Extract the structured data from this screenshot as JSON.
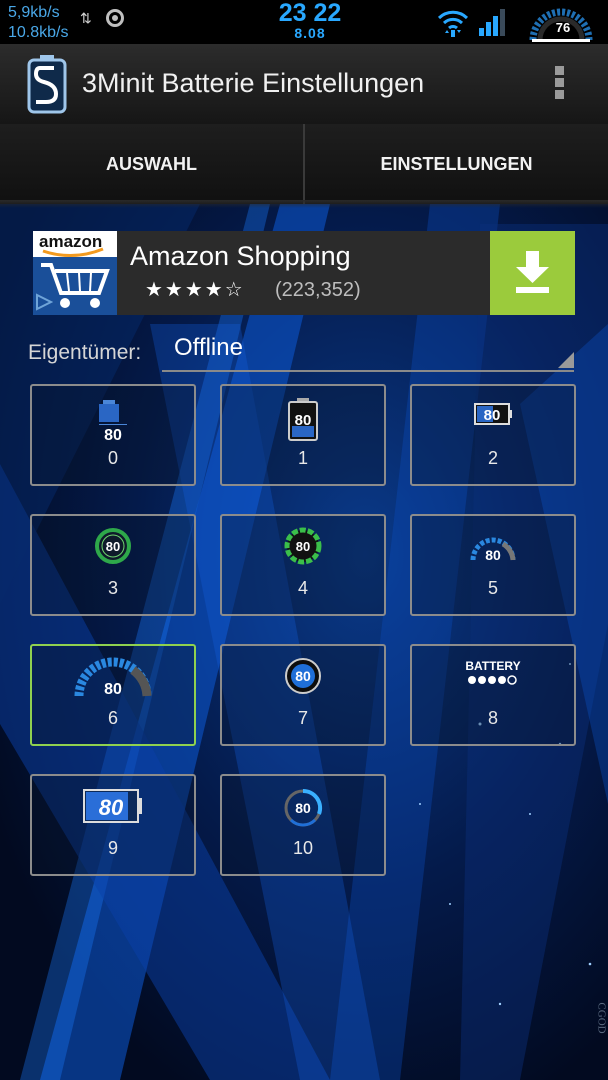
{
  "status_bar": {
    "upload_speed": "5,9kb/s",
    "download_speed": "10.8kb/s",
    "time": "23 22",
    "date": "8.08",
    "battery_level": "76"
  },
  "action_bar": {
    "title": "3Minit Batterie Einstellungen"
  },
  "tabs": [
    {
      "label": "AUSWAHL"
    },
    {
      "label": "EINSTELLUNGEN"
    }
  ],
  "ad": {
    "brand": "amazon",
    "title": "Amazon Shopping",
    "stars": "★★★★☆",
    "rating_count": "(223,352)"
  },
  "owner": {
    "label": "Eigentümer:",
    "value": "Offline"
  },
  "styles": [
    {
      "number": "0",
      "icon": "battery-vertical-icon",
      "value": "80",
      "selected": false
    },
    {
      "number": "1",
      "icon": "battery-boxed-icon",
      "value": "80",
      "selected": false
    },
    {
      "number": "2",
      "icon": "battery-horizontal-icon",
      "value": "80",
      "selected": false
    },
    {
      "number": "3",
      "icon": "green-ring-icon",
      "value": "80",
      "selected": false
    },
    {
      "number": "4",
      "icon": "dashed-green-ring-icon",
      "value": "80",
      "selected": false
    },
    {
      "number": "5",
      "icon": "gauge-arc-icon",
      "value": "80",
      "selected": false
    },
    {
      "number": "6",
      "icon": "speedometer-icon",
      "value": "80",
      "selected": true
    },
    {
      "number": "7",
      "icon": "blue-circle-icon",
      "value": "80",
      "selected": false
    },
    {
      "number": "8",
      "icon": "battery-dots-icon",
      "value": "BATTERY",
      "selected": false
    },
    {
      "number": "9",
      "icon": "battery-bar-icon",
      "value": "80",
      "selected": false
    },
    {
      "number": "10",
      "icon": "ring-arc-icon",
      "value": "80",
      "selected": false
    }
  ],
  "watermark": "CGOD",
  "colors": {
    "accent_blue": "#29a8ff",
    "selected_border": "#8fd14f",
    "download_green": "#9bcb3c"
  }
}
